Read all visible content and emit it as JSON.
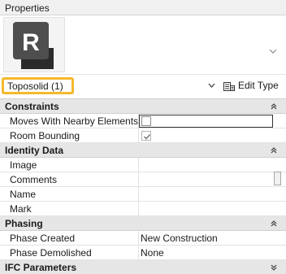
{
  "panel": {
    "title": "Properties"
  },
  "type_selector": {
    "logo_letter": "R",
    "selected_type": "Toposolid (1)",
    "edit_type_label": "Edit Type"
  },
  "groups": {
    "constraints": {
      "name": "Constraints",
      "moves_label": "Moves With Nearby Elements",
      "moves_checked": false,
      "room_label": "Room Bounding",
      "room_checked": true
    },
    "identity": {
      "name": "Identity Data",
      "image_label": "Image",
      "comments_label": "Comments",
      "name_label": "Name",
      "mark_label": "Mark"
    },
    "phasing": {
      "name": "Phasing",
      "created_label": "Phase Created",
      "created_value": "New Construction",
      "demolished_label": "Phase Demolished",
      "demolished_value": "None"
    },
    "ifc": {
      "name": "IFC Parameters"
    }
  },
  "colors": {
    "highlight": "#f5b82e",
    "group_header": "#e6e6e6",
    "logo_dark": "#3a3a3a"
  },
  "icons": [
    "revit-logo-icon",
    "chevron-down-icon",
    "edit-type-icon",
    "collapse-icon",
    "checkbox-icon"
  ]
}
